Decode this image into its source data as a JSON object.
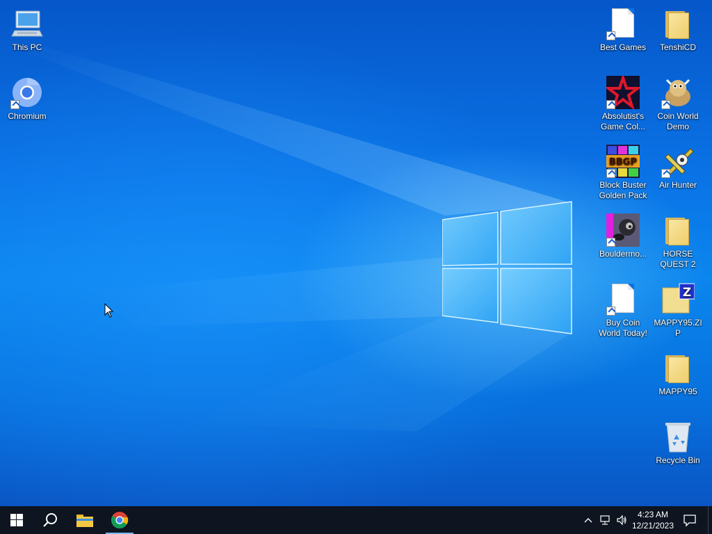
{
  "desktop": {
    "icons": [
      {
        "id": "this-pc",
        "label": "This PC"
      },
      {
        "id": "chromium",
        "label": "Chromium"
      },
      {
        "id": "best-games",
        "label": "Best Games"
      },
      {
        "id": "tenshicd",
        "label": "TenshiCD"
      },
      {
        "id": "absolutist",
        "label": "Absolutist's Game Col..."
      },
      {
        "id": "coin-world-demo",
        "label": "Coin World Demo"
      },
      {
        "id": "block-buster",
        "label": "Block Buster Golden Pack"
      },
      {
        "id": "air-hunter",
        "label": "Air Hunter"
      },
      {
        "id": "bouldermo",
        "label": "Bouldermo..."
      },
      {
        "id": "horse-quest",
        "label": "HORSE QUEST 2"
      },
      {
        "id": "buy-coin-world",
        "label": "Buy Coin World Today!"
      },
      {
        "id": "mappy95-zip",
        "label": "MAPPY95.ZIP"
      },
      {
        "id": "mappy95",
        "label": "MAPPY95"
      },
      {
        "id": "recycle-bin",
        "label": "Recycle Bin"
      }
    ],
    "block_buster_badge": "BBGP"
  },
  "taskbar": {
    "start_icon": "windows-start-icon",
    "search_icon": "search-icon",
    "pinned": [
      "file-explorer-icon",
      "chrome-icon"
    ],
    "tray": {
      "icons": [
        "chevron-up-icon",
        "network-icon",
        "volume-icon"
      ],
      "time": "4:23 AM",
      "date": "12/21/2023",
      "notification_icon": "action-center-icon"
    }
  },
  "colors": {
    "taskbar": "#0e1420",
    "desktop_accent": "#0a73e6",
    "active_indicator": "#76b9ed"
  }
}
